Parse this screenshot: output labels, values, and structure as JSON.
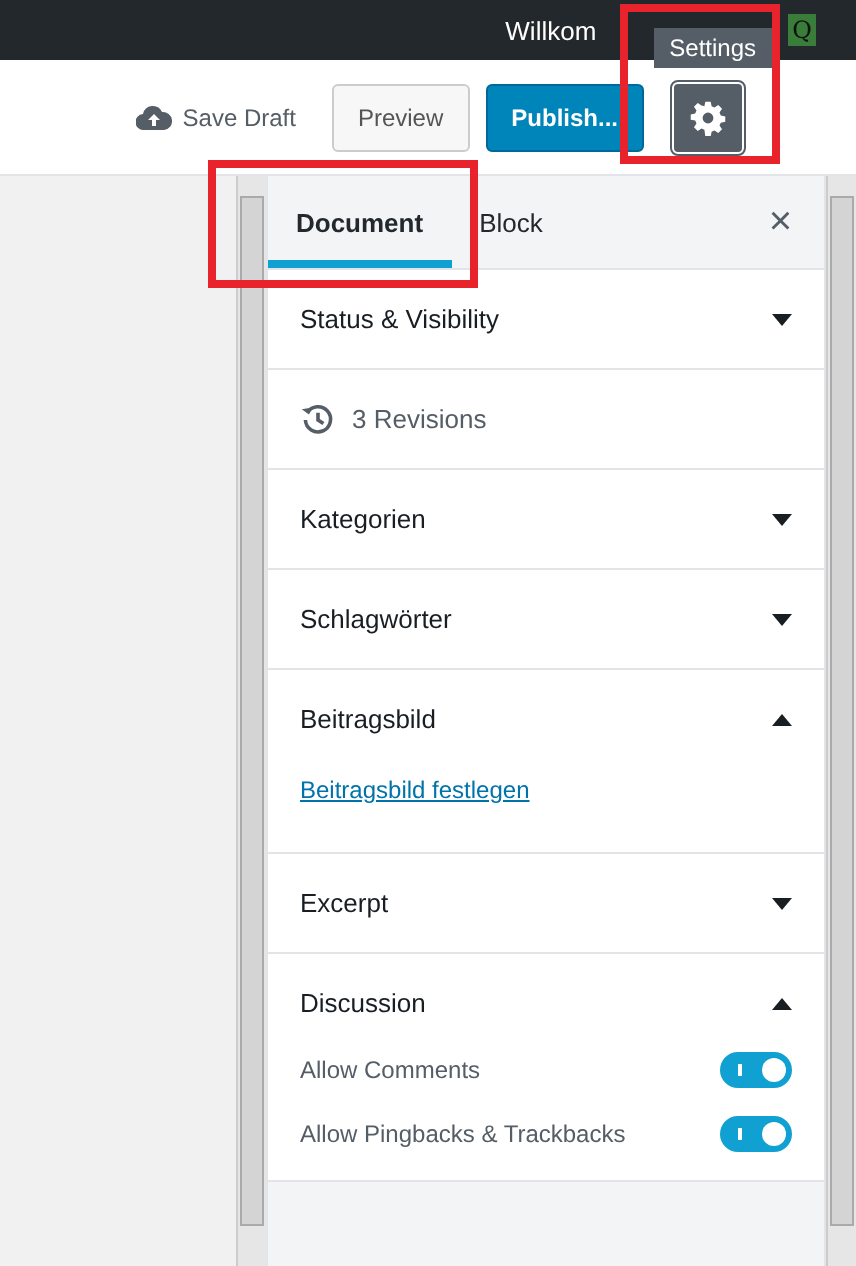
{
  "admin_bar": {
    "greeting": "Willkom",
    "avatar_letter": "Q"
  },
  "header": {
    "save_draft": "Save Draft",
    "preview": "Preview",
    "publish": "Publish...",
    "settings_tooltip": "Settings",
    "settings_selected": true
  },
  "tabs": [
    {
      "label": "Document",
      "selected": true
    },
    {
      "label": "Block",
      "selected": false
    }
  ],
  "close": "×",
  "panels": [
    {
      "kind": "section",
      "title": "Status & Visibility",
      "expanded": false
    },
    {
      "kind": "revisions",
      "title": "3 Revisions"
    },
    {
      "kind": "section",
      "title": "Kategorien",
      "expanded": false
    },
    {
      "kind": "section",
      "title": "Schlagwörter",
      "expanded": false
    },
    {
      "kind": "section",
      "title": "Beitragsbild",
      "expanded": true,
      "link": "Beitragsbild festlegen"
    },
    {
      "kind": "section",
      "title": "Excerpt",
      "expanded": false
    },
    {
      "kind": "section",
      "title": "Discussion",
      "expanded": true,
      "toggles": [
        {
          "label": "Allow Comments",
          "on": true
        },
        {
          "label": "Allow Pingbacks & Trackbacks",
          "on": true
        }
      ]
    }
  ]
}
